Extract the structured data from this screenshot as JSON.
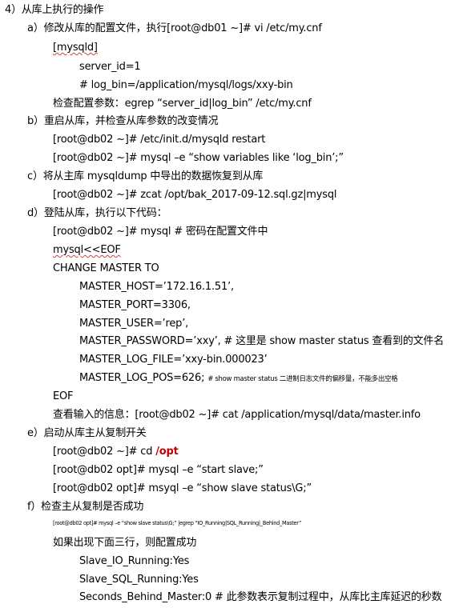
{
  "doc": {
    "l01": "4）从库上执行的操作",
    "l02": "a）修改从库的配置文件，执行[root@db01 ~]# vi /etc/my.cnf",
    "l03": "[mysqld]",
    "l04": "server_id=1",
    "l05": "# log_bin=/application/mysql/logs/xxy-bin",
    "l06": "检查配置参数：egrep “server_id|log_bin” /etc/my.cnf",
    "l07": "b）重启从库，并检查从库参数的改变情况",
    "l08": "[root@db02 ~]# /etc/init.d/mysqld restart",
    "l09": "[root@db02 ~]# mysql –e “show variables like ‘log_bin’;”",
    "l10": "c）将从主库 mysqldump 中导出的数据恢复到从库",
    "l11": "[root@db02 ~]# zcat /opt/bak_2017-09-12.sql.gz|mysql",
    "l12": "d）登陆从库，执行以下代码：",
    "l13": "[root@db02 ~]# mysql # 密码在配置文件中",
    "l14": "mysql<<EOF",
    "l15": "CHANGE MASTER TO",
    "l16": "MASTER_HOST=’172.16.1.51’,",
    "l17": "MASTER_PORT=3306,",
    "l18": "MASTER_USER=’rep’,",
    "l19": "MASTER_PASSWORD=’xxy’, # 这里是 show master status 查看到的文件名",
    "l20a": "MASTER_LOG_FILE=’xxy-bin.000023’",
    "l21a": "MASTER_LOG_POS=626; ",
    "l21b": "# show master status 二进制日志文件的偏移量，不能多出空格",
    "l22": "EOF",
    "l23": "查看输入的信息：[root@db02 ~]# cat /application/mysql/data/master.info",
    "l24": "e）启动从库主从复制开关",
    "l25a": "[root@db02 ~]# cd ",
    "l25b": "/opt",
    "l26": "[root@db02 opt]# mysql –e “start slave;”",
    "l27": "[root@db02 opt]# msyql –e “show slave status\\G;”",
    "l28": "f）检查主从复制是否成功",
    "l29": "[root@db02 opt]# mysql –e “show slave status\\G;” |egrep “IO_Running|SQL_Running|_Behind_Master”",
    "l30": "如果出现下面三行，则配置成功",
    "l31": "Slave_IO_Running:Yes",
    "l32": "Slave_SQL_Running:Yes",
    "l33": "Seconds_Behind_Master:0 # 此参数表示复制过程中，从库比主库延迟的秒数"
  }
}
